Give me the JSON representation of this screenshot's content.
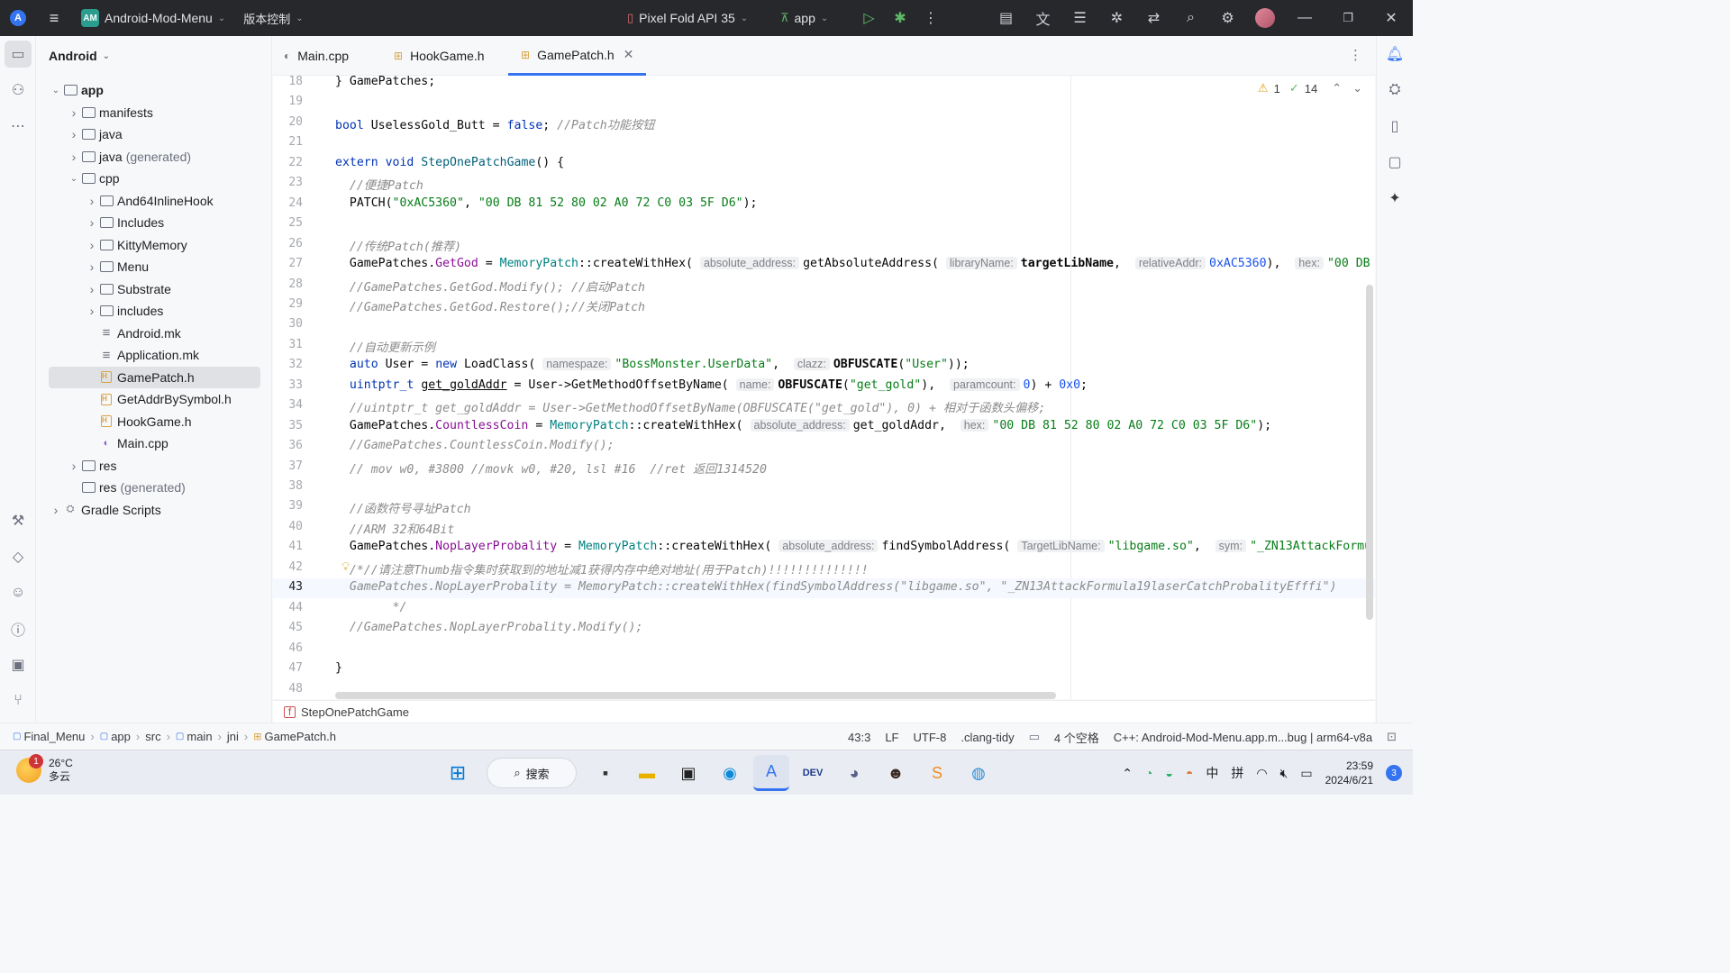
{
  "titlebar": {
    "project_badge": "AM",
    "project_name": "Android-Mod-Menu",
    "vcs": "版本控制",
    "device": "Pixel Fold API 35",
    "run_config": "app"
  },
  "project_panel": {
    "view": "Android",
    "tree": [
      {
        "label": "app",
        "depth": 0,
        "kind": "module",
        "expanded": true,
        "bold": true
      },
      {
        "label": "manifests",
        "depth": 1,
        "kind": "folder",
        "expanded": false
      },
      {
        "label": "java",
        "depth": 1,
        "kind": "folder",
        "expanded": false
      },
      {
        "label": "java",
        "suffix": "(generated)",
        "depth": 1,
        "kind": "folder",
        "expanded": false
      },
      {
        "label": "cpp",
        "depth": 1,
        "kind": "folder",
        "expanded": true
      },
      {
        "label": "And64InlineHook",
        "depth": 2,
        "kind": "folder",
        "expanded": false
      },
      {
        "label": "Includes",
        "depth": 2,
        "kind": "folder",
        "expanded": false
      },
      {
        "label": "KittyMemory",
        "depth": 2,
        "kind": "folder",
        "expanded": false
      },
      {
        "label": "Menu",
        "depth": 2,
        "kind": "folder",
        "expanded": false
      },
      {
        "label": "Substrate",
        "depth": 2,
        "kind": "folder",
        "expanded": false
      },
      {
        "label": "includes",
        "depth": 2,
        "kind": "folder",
        "expanded": false
      },
      {
        "label": "Android.mk",
        "depth": 2,
        "kind": "mk"
      },
      {
        "label": "Application.mk",
        "depth": 2,
        "kind": "mk"
      },
      {
        "label": "GamePatch.h",
        "depth": 2,
        "kind": "h",
        "selected": true
      },
      {
        "label": "GetAddrBySymbol.h",
        "depth": 2,
        "kind": "h"
      },
      {
        "label": "HookGame.h",
        "depth": 2,
        "kind": "h"
      },
      {
        "label": "Main.cpp",
        "depth": 2,
        "kind": "cpp"
      },
      {
        "label": "res",
        "depth": 1,
        "kind": "folder",
        "expanded": false
      },
      {
        "label": "res",
        "suffix": "(generated)",
        "depth": 1,
        "kind": "folder"
      },
      {
        "label": "Gradle Scripts",
        "depth": 0,
        "kind": "gradle",
        "expanded": false
      }
    ]
  },
  "tabs": [
    {
      "label": "Main.cpp",
      "active": false
    },
    {
      "label": "HookGame.h",
      "active": false
    },
    {
      "label": "GamePatch.h",
      "active": true
    }
  ],
  "inspection": {
    "warnings": "1",
    "checks": "14"
  },
  "editor": {
    "current_line": 43,
    "lines": [
      {
        "n": 18,
        "html": "} GamePatches;"
      },
      {
        "n": 19,
        "html": ""
      },
      {
        "n": 20,
        "html": "<span class='kw'>bool</span> UselessGold_Butt = <span class='kw'>false</span>; <span class='cm'>//Patch功能按钮</span>"
      },
      {
        "n": 21,
        "html": ""
      },
      {
        "n": 22,
        "html": "<span class='kw'>extern void</span> <span class='fn'>StepOnePatchGame</span>() {"
      },
      {
        "n": 23,
        "html": "  <span class='cm'>//便捷Patch</span>"
      },
      {
        "n": 24,
        "html": "  PATCH(<span class='str'>\"0xAC5360\"</span>, <span class='str'>\"00 DB 81 52 80 02 A0 72 C0 03 5F D6\"</span>);"
      },
      {
        "n": 25,
        "html": ""
      },
      {
        "n": 26,
        "html": "  <span class='cm'>//传统Patch(推荐)</span>"
      },
      {
        "n": 27,
        "html": "  GamePatches.<span class='fld'>GetGod</span> = <span class='cls'>MemoryPatch</span>::createWithHex( <span class='hint'>absolute_address:</span>getAbsoluteAddress( <span class='hint'>libraryName:</span><b>targetLibName</b>,  <span class='hint'>relativeAddr:</span><span class='num'>0xAC5360</span>),  <span class='hint'>hex:</span><span class='str'>\"00 DB</span>"
      },
      {
        "n": 28,
        "html": "  <span class='cm'>//GamePatches.GetGod.Modify(); //启动Patch</span>"
      },
      {
        "n": 29,
        "html": "  <span class='cm'>//GamePatches.GetGod.Restore();//关闭Patch</span>"
      },
      {
        "n": 30,
        "html": ""
      },
      {
        "n": 31,
        "html": "  <span class='cm'>//自动更新示例</span>"
      },
      {
        "n": 32,
        "html": "  <span class='kw'>auto</span> User = <span class='kw'>new</span> LoadClass( <span class='hint'>namespaze:</span><span class='str'>\"BossMonster.UserData\"</span>,  <span class='hint'>clazz:</span><b>OBFUSCATE</b>(<span class='str'>\"User\"</span>));"
      },
      {
        "n": 33,
        "html": "  <span class='kw'>uintptr_t</span> <u>get_goldAddr</u> = User-&gt;GetMethodOffsetByName( <span class='hint'>name:</span><b>OBFUSCATE</b>(<span class='str'>\"get_gold\"</span>),  <span class='hint'>paramcount:</span><span class='num'>0</span>) + <span class='num'>0x0</span>;"
      },
      {
        "n": 34,
        "html": "  <span class='cm'>//uintptr_t get_goldAddr = User-&gt;GetMethodOffsetByName(OBFUSCATE(\"get_gold\"), 0) + 相对于函数头偏移;</span>"
      },
      {
        "n": 35,
        "html": "  GamePatches.<span class='fld'>CountlessCoin</span> = <span class='cls'>MemoryPatch</span>::createWithHex( <span class='hint'>absolute_address:</span>get_goldAddr,  <span class='hint'>hex:</span><span class='str'>\"00 DB 81 52 80 02 A0 72 C0 03 5F D6\"</span>);"
      },
      {
        "n": 36,
        "html": "  <span class='cm'>//GamePatches.CountlessCoin.Modify();</span>"
      },
      {
        "n": 37,
        "html": "  <span class='cm'>// mov w0, #3800 //movk w0, #20, lsl #16  //ret 返回1314520</span>"
      },
      {
        "n": 38,
        "html": ""
      },
      {
        "n": 39,
        "html": "  <span class='cm'>//函数符号寻址Patch</span>"
      },
      {
        "n": 40,
        "html": "  <span class='cm'>//ARM 32和64Bit</span>"
      },
      {
        "n": 41,
        "html": "  GamePatches.<span class='fld'>NopLayerProbality</span> = <span class='cls'>MemoryPatch</span>::createWithHex( <span class='hint'>absolute_address:</span>findSymbolAddress( <span class='hint'>TargetLibName:</span><span class='str'>\"libgame.so\"</span>,  <span class='hint'>sym:</span><span class='str'>\"_ZN13AttackFormu</span>"
      },
      {
        "n": 42,
        "html": "  <span class='cm'>/*//请注意Thumb指令集时获取到的地址减1获得内存中绝对地址(用于Patch)!!!!!!!!!!!!!!</span>"
      },
      {
        "n": 43,
        "html": "  <span class='cm'>GamePatches.NopLayerProbality = MemoryPatch::createWithHex(findSymbolAddress(\"libgame.so\", \"_ZN13AttackFormula19laserCatchProbalityEfffi\")</span>"
      },
      {
        "n": 44,
        "html": "        <span class='cm'>*/</span>"
      },
      {
        "n": 45,
        "html": "  <span class='cm'>//GamePatches.NopLayerProbality.Modify();</span>"
      },
      {
        "n": 46,
        "html": ""
      },
      {
        "n": 47,
        "html": "}"
      },
      {
        "n": 48,
        "html": ""
      }
    ]
  },
  "editor_breadcrumb": "StepOnePatchGame",
  "statusbar": {
    "path": [
      "Final_Menu",
      "app",
      "src",
      "main",
      "jni",
      "GamePatch.h"
    ],
    "position": "43:3",
    "line_sep": "LF",
    "encoding": "UTF-8",
    "linter": ".clang-tidy",
    "indent": "4 个空格",
    "context": "C++: Android-Mod-Menu.app.m...bug | arm64-v8a"
  },
  "taskbar": {
    "temperature": "26°C",
    "weather": "多云",
    "weather_badge": "1",
    "search": "搜索",
    "ime_lang": "中",
    "ime_mode": "拼",
    "time": "23:59",
    "date": "2024/6/21",
    "notif_count": "3"
  }
}
